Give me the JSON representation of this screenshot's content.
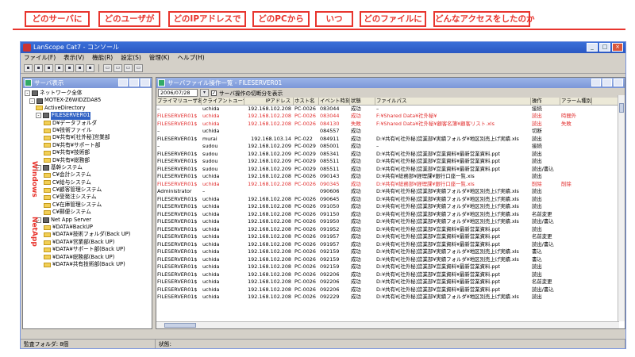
{
  "callouts": [
    {
      "label": "どのサーバに"
    },
    {
      "label": "どのユーザが"
    },
    {
      "label": "どのIPアドレスで"
    },
    {
      "label": "どのPCから"
    },
    {
      "label": "いつ"
    },
    {
      "label": "どのファイルに"
    },
    {
      "label": "どんなアクセスをしたのか"
    }
  ],
  "accent_color": "#e8352e",
  "app": {
    "title": "LanScope Cat7 - コンソール",
    "menu": [
      "ファイル(F)",
      "表示(V)",
      "機能(R)",
      "設定(S)",
      "管理(K)",
      "ヘルプ(H)"
    ]
  },
  "server_pane": {
    "title": "サーバ表示",
    "side_labels": {
      "windows": "Windows",
      "netapp": "NetApp"
    },
    "tree": [
      {
        "label": "ネットワーク全体",
        "type": "server",
        "toggle": "-"
      },
      {
        "label": "MOTEX-Z6WIDZDA85",
        "type": "server",
        "toggle": "-"
      },
      {
        "label": "ActiveDirectory",
        "type": "folder",
        "toggle": ""
      },
      {
        "label": "FILESERVER01",
        "type": "server",
        "toggle": "-",
        "selected": true
      },
      {
        "label": "D¥データフォルダ",
        "type": "folder",
        "toggle": ""
      },
      {
        "label": "D¥技術ファイル",
        "type": "folder",
        "toggle": ""
      },
      {
        "label": "D¥共有¥[社外秘]営業部",
        "type": "folder",
        "toggle": ""
      },
      {
        "label": "D¥共有¥サポート部",
        "type": "folder",
        "toggle": ""
      },
      {
        "label": "D¥共有¥技術部",
        "type": "folder",
        "toggle": ""
      },
      {
        "label": "D¥共有¥総務部",
        "type": "folder",
        "toggle": ""
      },
      {
        "label": "基幹システム",
        "type": "server",
        "toggle": "-"
      },
      {
        "label": "C¥会計システム",
        "type": "folder",
        "toggle": ""
      },
      {
        "label": "C¥給与システム",
        "type": "folder",
        "toggle": ""
      },
      {
        "label": "C¥顧客管理システム",
        "type": "folder",
        "toggle": ""
      },
      {
        "label": "C¥受発注システム",
        "type": "folder",
        "toggle": ""
      },
      {
        "label": "C¥在庫管理システム",
        "type": "folder",
        "toggle": ""
      },
      {
        "label": "C¥郵便システム",
        "type": "folder",
        "toggle": ""
      },
      {
        "label": "Net App Server",
        "type": "server",
        "toggle": "-"
      },
      {
        "label": "¥DATA¥BackUP",
        "type": "folder",
        "toggle": ""
      },
      {
        "label": "¥DATA¥技術フォルダ(Back UP)",
        "type": "folder",
        "toggle": ""
      },
      {
        "label": "¥DATA¥営業部(Back UP)",
        "type": "folder",
        "toggle": ""
      },
      {
        "label": "¥DATA¥サポート部(Back UP)",
        "type": "folder",
        "toggle": ""
      },
      {
        "label": "¥DATA¥総務部(Back UP)",
        "type": "folder",
        "toggle": ""
      },
      {
        "label": "¥DATA¥共有技術部(Back UP)",
        "type": "folder",
        "toggle": ""
      }
    ]
  },
  "log_window": {
    "title": "サーバファイル操作一覧 - FILESERVER01",
    "date": "2006/07/28",
    "filter_label": "サーバ操作の切断分を表示",
    "columns": [
      "プライマリユーザ名",
      "クライアントユーザ名",
      "IPアドレス",
      "ホスト名",
      "イベント時刻",
      "状態",
      "ファイルパス",
      "操作",
      "アラーム種別"
    ],
    "rows": [
      {
        "c": [
          "–",
          "uchida",
          "192.168.102.208",
          "PC-0026",
          "083044",
          "成功",
          "–",
          "接続",
          ""
        ],
        "red": false
      },
      {
        "c": [
          "FILESERVER01$",
          "uchida",
          "192.168.102.208",
          "PC-0026",
          "083044",
          "成功",
          "F:¥Shared Data¥社外秘¥",
          "読出",
          "時間外"
        ],
        "red": true
      },
      {
        "c": [
          "FILESERVER01$",
          "uchida",
          "192.168.102.208",
          "PC-0026",
          "084130",
          "失敗",
          "F:¥Shared Data¥社外秘¥顧客名簿¥顧客リスト.xls",
          "読出",
          "失敗"
        ],
        "red": true
      },
      {
        "c": [
          "–",
          "uchida",
          "",
          "",
          "084557",
          "成功",
          "",
          "切断",
          ""
        ],
        "red": false
      },
      {
        "c": [
          "FILESERVER01$",
          "murai",
          "192.168.103.14",
          "PC-022",
          "084911",
          "成功",
          "D:¥共有¥[社外秘]営業部¥実績フォルダ¥地区別売上げ実績.xls",
          "読出",
          ""
        ],
        "red": false
      },
      {
        "c": [
          "–",
          "sudou",
          "192.168.102.209",
          "PC-0029",
          "085001",
          "成功",
          "–",
          "接続",
          ""
        ],
        "red": false
      },
      {
        "c": [
          "FILESERVER01$",
          "sudou",
          "192.168.102.209",
          "PC-0029",
          "085341",
          "成功",
          "D:¥共有¥[社外秘]営業部¥営業資料¥最新営業資料.ppt",
          "読出",
          ""
        ],
        "red": false
      },
      {
        "c": [
          "FILESERVER01$",
          "sudou",
          "192.168.102.209",
          "PC-0029",
          "085511",
          "成功",
          "D:¥共有¥[社外秘]営業部¥営業資料¥最新営業資料.ppt",
          "読出",
          ""
        ],
        "red": false
      },
      {
        "c": [
          "FILESERVER01$",
          "sudou",
          "192.168.102.209",
          "PC-0029",
          "085511",
          "成功",
          "D:¥共有¥[社外秘]営業部¥営業資料¥最新営業資料.ppt",
          "読出/書込",
          ""
        ],
        "red": false
      },
      {
        "c": [
          "FILESERVER01$",
          "uchida",
          "192.168.102.208",
          "PC-0026",
          "090143",
          "成功",
          "D:¥共有¥総務部¥経理課¥銀行口座一覧.xls",
          "読出",
          ""
        ],
        "red": false
      },
      {
        "c": [
          "FILESERVER01$",
          "uchida",
          "192.168.102.208",
          "PC-0026",
          "090345",
          "成功",
          "D:¥共有¥総務部¥経理課¥銀行口座一覧.xls",
          "削除",
          "削除"
        ],
        "red": true
      },
      {
        "c": [
          "Administrator",
          "–",
          "",
          "",
          "090606",
          "成功",
          "D:¥共有¥[社外秘]営業部¥実績フォルダ¥地区別売上げ実績.xls",
          "読出",
          ""
        ],
        "red": false
      },
      {
        "c": [
          "FILESERVER01$",
          "uchida",
          "192.168.102.208",
          "PC-0026",
          "090645",
          "成功",
          "D:¥共有¥[社外秘]営業部¥実績フォルダ¥地区別売上げ実績.xls",
          "読出",
          ""
        ],
        "red": false
      },
      {
        "c": [
          "FILESERVER01$",
          "uchida",
          "192.168.102.208",
          "PC-0026",
          "091050",
          "成功",
          "D:¥共有¥[社外秘]営業部¥実績フォルダ¥地区別売上げ実績.xls",
          "読出",
          ""
        ],
        "red": false
      },
      {
        "c": [
          "FILESERVER01$",
          "uchida",
          "192.168.102.208",
          "PC-0026",
          "091150",
          "成功",
          "D:¥共有¥[社外秘]営業部¥実績フォルダ¥地区別売上げ実績.xls",
          "名前変更",
          ""
        ],
        "red": false
      },
      {
        "c": [
          "FILESERVER01$",
          "uchida",
          "192.168.102.208",
          "PC-0026",
          "091950",
          "成功",
          "D:¥共有¥[社外秘]営業部¥実績フォルダ¥地区別売上げ実績.xls",
          "読出/書込",
          ""
        ],
        "red": false
      },
      {
        "c": [
          "FILESERVER01$",
          "uchida",
          "192.168.102.208",
          "PC-0026",
          "091952",
          "成功",
          "D:¥共有¥[社外秘]営業部¥営業資料¥最新営業資料.ppt",
          "読出",
          ""
        ],
        "red": false
      },
      {
        "c": [
          "FILESERVER01$",
          "uchida",
          "192.168.102.208",
          "PC-0026",
          "091957",
          "成功",
          "D:¥共有¥[社外秘]営業部¥営業資料¥最新営業資料.ppt",
          "名前変更",
          ""
        ],
        "red": false
      },
      {
        "c": [
          "FILESERVER01$",
          "uchida",
          "192.168.102.208",
          "PC-0026",
          "091957",
          "成功",
          "D:¥共有¥[社外秘]営業部¥営業資料¥最新営業資料.ppt",
          "読出/書込",
          ""
        ],
        "red": false
      },
      {
        "c": [
          "FILESERVER01$",
          "uchida",
          "192.168.102.208",
          "PC-0026",
          "092159",
          "成功",
          "D:¥共有¥[社外秘]営業部¥実績フォルダ¥地区別売上げ実績.xls",
          "書込",
          ""
        ],
        "red": false
      },
      {
        "c": [
          "FILESERVER01$",
          "uchida",
          "192.168.102.208",
          "PC-0026",
          "092159",
          "成功",
          "D:¥共有¥[社外秘]営業部¥実績フォルダ¥地区別売上げ実績.xls",
          "書込",
          ""
        ],
        "red": false
      },
      {
        "c": [
          "FILESERVER01$",
          "uchida",
          "192.168.102.208",
          "PC-0026",
          "092159",
          "成功",
          "D:¥共有¥[社外秘]営業部¥営業資料¥最新営業資料.ppt",
          "読出",
          ""
        ],
        "red": false
      },
      {
        "c": [
          "FILESERVER01$",
          "uchida",
          "192.168.102.208",
          "PC-0026",
          "092206",
          "成功",
          "D:¥共有¥[社外秘]営業部¥営業資料¥最新営業資料.ppt",
          "読出",
          ""
        ],
        "red": false
      },
      {
        "c": [
          "FILESERVER01$",
          "uchida",
          "192.168.102.208",
          "PC-0026",
          "092206",
          "成功",
          "D:¥共有¥[社外秘]営業部¥営業資料¥最新営業資料.ppt",
          "名前変更",
          ""
        ],
        "red": false
      },
      {
        "c": [
          "FILESERVER01$",
          "uchida",
          "192.168.102.208",
          "PC-0026",
          "092206",
          "成功",
          "D:¥共有¥[社外秘]営業部¥営業資料¥最新営業資料.ppt",
          "読出/書込",
          ""
        ],
        "red": false
      },
      {
        "c": [
          "FILESERVER01$",
          "uchida",
          "192.168.102.208",
          "PC-0026",
          "092229",
          "成功",
          "D:¥共有¥[社外秘]営業部¥実績フォルダ¥地区別売上げ実績.xls",
          "読出",
          ""
        ],
        "red": false
      }
    ]
  },
  "statusbar": {
    "left": "監査フォルダ: 8個",
    "middle": "状態:"
  }
}
